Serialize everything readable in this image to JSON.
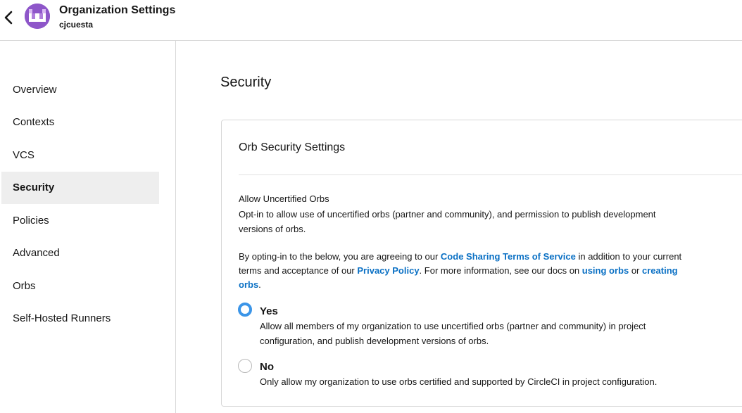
{
  "header": {
    "title": "Organization Settings",
    "subtitle": "cjcuesta",
    "back_icon": "chevron-left-icon",
    "avatar_color": "#8e56c9"
  },
  "sidebar": {
    "items": [
      {
        "label": "Overview",
        "active": false
      },
      {
        "label": "Contexts",
        "active": false
      },
      {
        "label": "VCS",
        "active": false
      },
      {
        "label": "Security",
        "active": true
      },
      {
        "label": "Policies",
        "active": false
      },
      {
        "label": "Advanced",
        "active": false
      },
      {
        "label": "Orbs",
        "active": false
      },
      {
        "label": "Self-Hosted Runners",
        "active": false
      }
    ]
  },
  "main": {
    "page_title": "Security",
    "card": {
      "title": "Orb Security Settings",
      "section_label": "Allow Uncertified Orbs",
      "section_desc": "Opt-in to allow use of uncertified orbs (partner and community), and permission to publish development versions of orbs.",
      "terms": {
        "t1": "By opting-in to the below, you are agreeing to our ",
        "link_cs": "Code Sharing Terms of Service",
        "t2": " in addition to your current terms and acceptance of our ",
        "link_pp": "Privacy Policy",
        "t3": ". For more information, see our docs on ",
        "link_using": "using orbs",
        "t4": " or ",
        "link_creating": "creating orbs",
        "t5": "."
      },
      "options": {
        "yes": {
          "label": "Yes",
          "desc": "Allow all members of my organization to use uncertified orbs (partner and community) in project configuration, and publish development versions of orbs.",
          "selected": true
        },
        "no": {
          "label": "No",
          "desc": "Only allow my organization to use orbs certified and supported by CircleCI in project configuration.",
          "selected": false
        }
      }
    }
  },
  "colors": {
    "link": "#0a70c4",
    "radio_selected": "#3b95e8",
    "active_sidebar_bg": "#eeeeee"
  }
}
